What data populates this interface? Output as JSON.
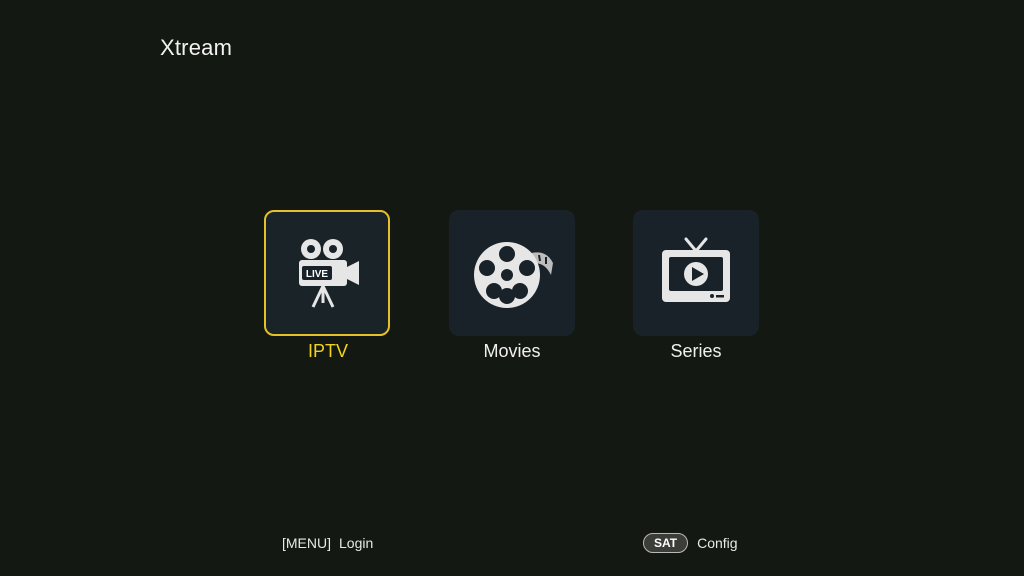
{
  "header": {
    "title": "Xtream"
  },
  "menu": {
    "selected_index": 0,
    "items": [
      {
        "label": "IPTV",
        "icon": "live-camera-icon",
        "badge": "LIVE"
      },
      {
        "label": "Movies",
        "icon": "film-reel-icon"
      },
      {
        "label": "Series",
        "icon": "tv-play-icon"
      }
    ]
  },
  "footer": {
    "login_key": "[MENU]",
    "login_label": "Login",
    "config_key": "SAT",
    "config_label": "Config"
  },
  "colors": {
    "background": "#141812",
    "tile": "#192228",
    "accent": "#e4c12a",
    "selected_text": "#f2d21e"
  }
}
